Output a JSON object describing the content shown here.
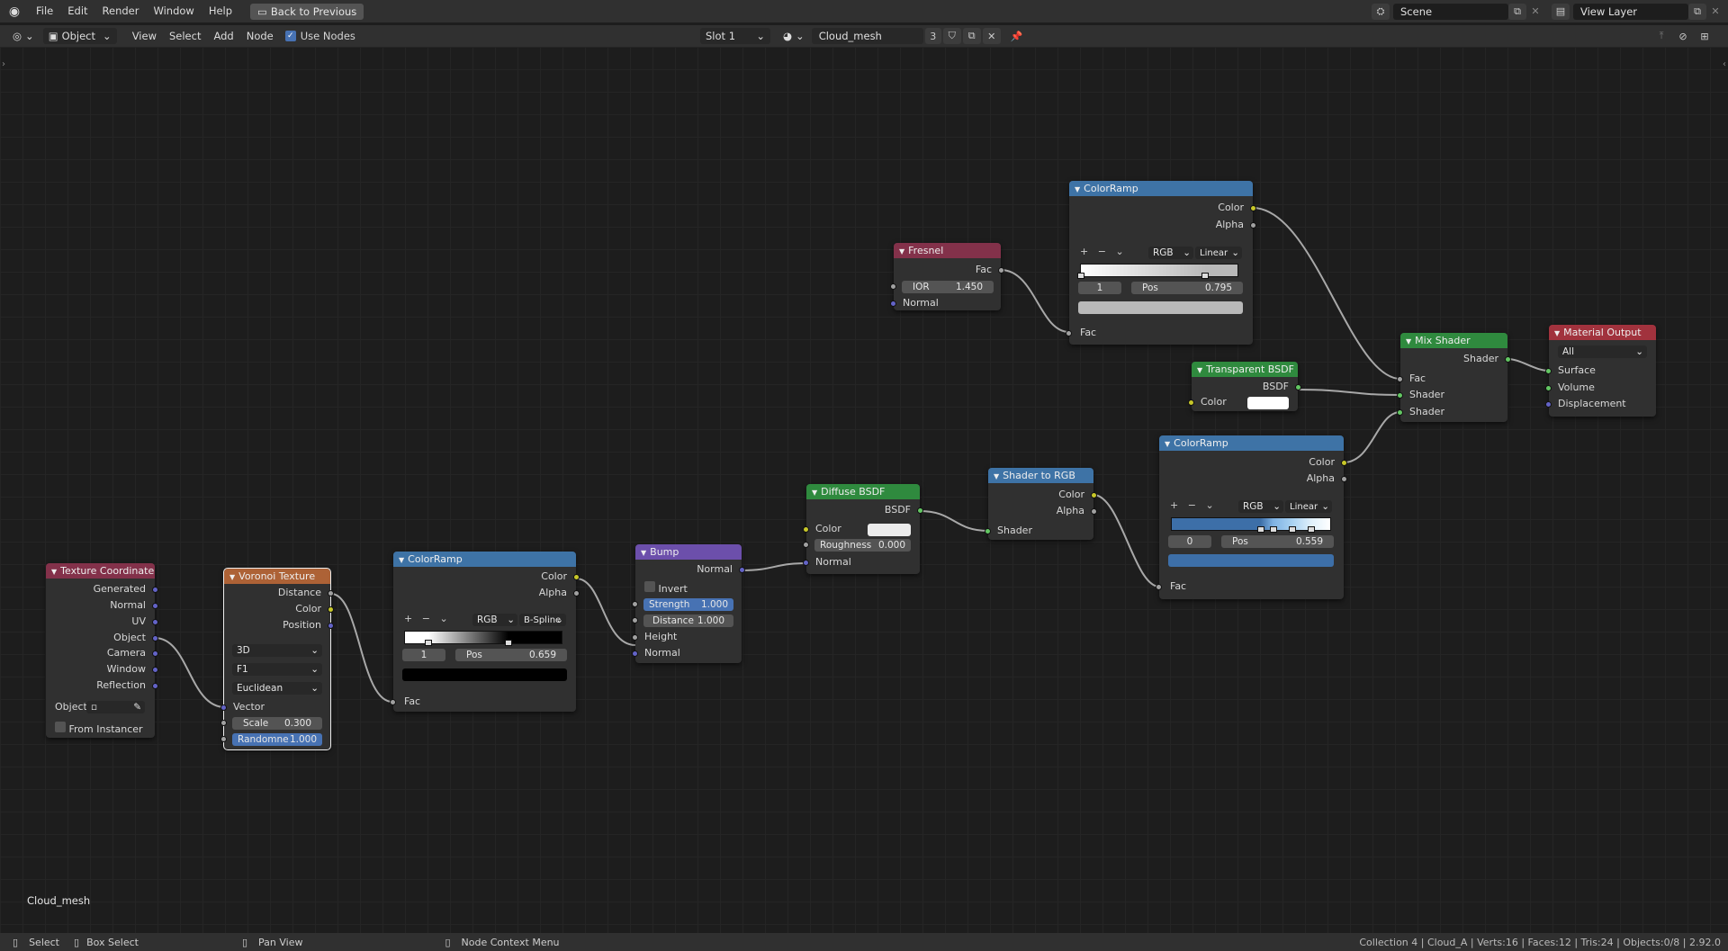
{
  "topbar": {
    "menus": [
      "File",
      "Edit",
      "Render",
      "Window",
      "Help"
    ],
    "back_label": "Back to Previous",
    "scene": "Scene",
    "view_layer": "View Layer"
  },
  "header": {
    "mode": "Object",
    "menus": [
      "View",
      "Select",
      "Add",
      "Node"
    ],
    "use_nodes_label": "Use Nodes",
    "slot": "Slot 1",
    "material": "Cloud_mesh",
    "users": "3"
  },
  "overlay_label": "Cloud_mesh",
  "nodes": {
    "texcoord": {
      "title": "Texture Coordinate",
      "outputs": [
        "Generated",
        "Normal",
        "UV",
        "Object",
        "Camera",
        "Window",
        "Reflection"
      ],
      "object_label": "Object:",
      "from_instancer": "From Instancer"
    },
    "voronoi": {
      "title": "Voronoi Texture",
      "outputs": [
        "Distance",
        "Color",
        "Position"
      ],
      "dim": "3D",
      "feature": "F1",
      "metric": "Euclidean",
      "vector_label": "Vector",
      "scale_label": "Scale",
      "scale_value": "0.300",
      "rand_label": "Randomne",
      "rand_value": "1.000"
    },
    "ramp1": {
      "title": "ColorRamp",
      "out_color": "Color",
      "out_alpha": "Alpha",
      "mode": "RGB",
      "interp": "B-Spline",
      "index": "1",
      "pos_label": "Pos",
      "pos_value": "0.659",
      "fac": "Fac",
      "stops": [
        0.15,
        0.66
      ]
    },
    "bump": {
      "title": "Bump",
      "out": "Normal",
      "invert": "Invert",
      "strength_label": "Strength",
      "strength_value": "1.000",
      "distance_label": "Distance",
      "distance_value": "1.000",
      "height": "Height",
      "normal": "Normal"
    },
    "diffuse": {
      "title": "Diffuse BSDF",
      "out": "BSDF",
      "color": "Color",
      "rough_label": "Roughness",
      "rough_value": "0.000",
      "normal": "Normal"
    },
    "s2rgb": {
      "title": "Shader to RGB",
      "out_color": "Color",
      "out_alpha": "Alpha",
      "shader": "Shader"
    },
    "fresnel": {
      "title": "Fresnel",
      "out": "Fac",
      "ior_label": "IOR",
      "ior_value": "1.450",
      "normal": "Normal"
    },
    "ramp2": {
      "title": "ColorRamp",
      "out_color": "Color",
      "out_alpha": "Alpha",
      "mode": "RGB",
      "interp": "Linear",
      "index": "1",
      "pos_label": "Pos",
      "pos_value": "0.795",
      "fac": "Fac",
      "stops": [
        0.0,
        0.795
      ]
    },
    "transparent": {
      "title": "Transparent BSDF",
      "out": "BSDF",
      "color": "Color"
    },
    "ramp3": {
      "title": "ColorRamp",
      "out_color": "Color",
      "out_alpha": "Alpha",
      "mode": "RGB",
      "interp": "Linear",
      "index": "0",
      "pos_label": "Pos",
      "pos_value": "0.559",
      "fac": "Fac",
      "stops": [
        0.56,
        0.64,
        0.76,
        0.88
      ]
    },
    "mix": {
      "title": "Mix Shader",
      "out": "Shader",
      "fac": "Fac",
      "shader1": "Shader",
      "shader2": "Shader"
    },
    "output": {
      "title": "Material Output",
      "target": "All",
      "surface": "Surface",
      "volume": "Volume",
      "displacement": "Displacement"
    }
  },
  "status": {
    "select": "Select",
    "box_select": "Box Select",
    "pan_view": "Pan View",
    "context_menu": "Node Context Menu",
    "stats": "Collection 4 | Cloud_A | Verts:16 | Faces:12 | Tris:24 | Objects:0/8 | 2.92.0"
  }
}
